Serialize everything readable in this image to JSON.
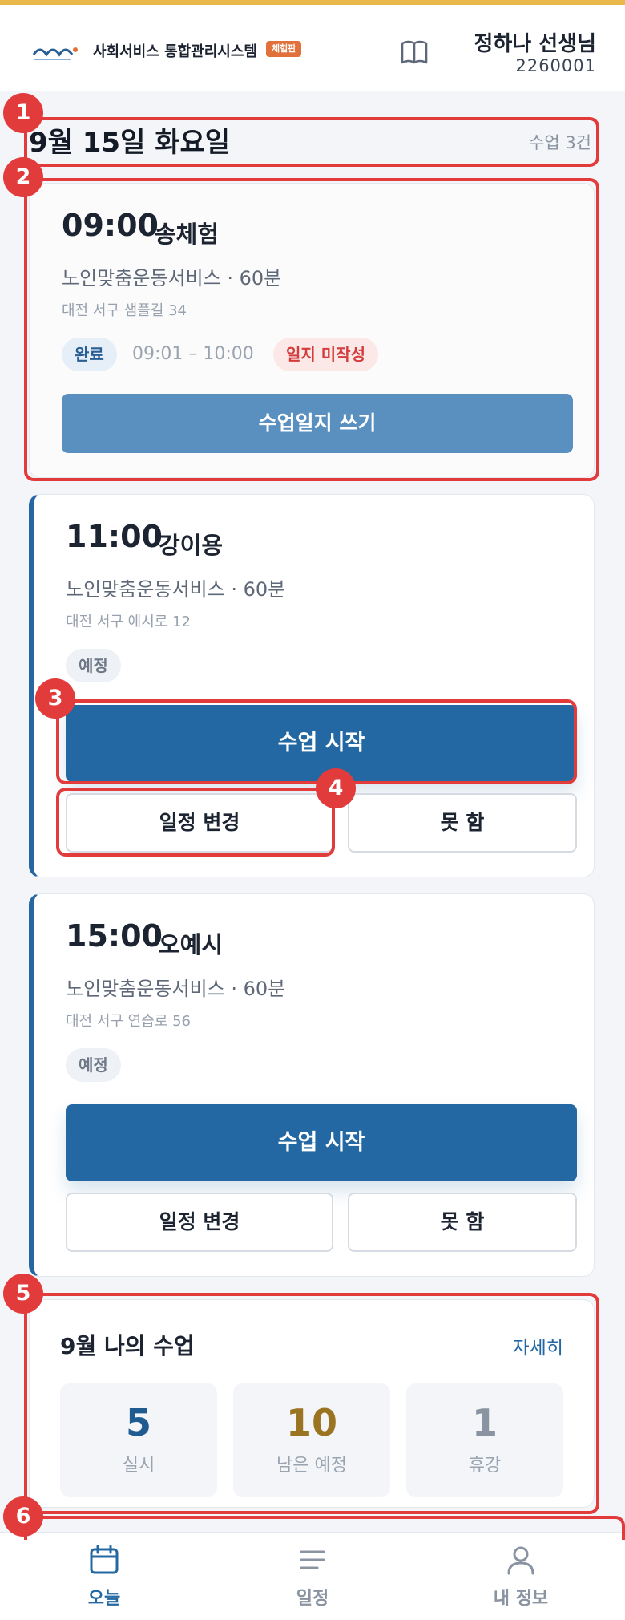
{
  "header": {
    "brand": "사회서비스 통합관리시스템",
    "badge": "체험판",
    "user_name": "정하나 선생님",
    "user_id": "2260001"
  },
  "date_row": {
    "title": "9월 15일 화요일",
    "count": "수업 3건"
  },
  "lessons": [
    {
      "time": "09:00",
      "name": "송체험",
      "service": "노인맞춤운동서비스 · 60분",
      "address": "대전 서구 샘플길 34",
      "status": "완료",
      "done_time": "09:01 – 10:00",
      "warn": "일지 미작성",
      "write_button": "수업일지 쓰기"
    },
    {
      "time": "11:00",
      "name": "강이용",
      "service": "노인맞춤운동서비스 · 60분",
      "address": "대전 서구 예시로 12",
      "status": "예정",
      "start_button": "수업 시작",
      "change_button": "일정 변경",
      "cancel_button": "못 함"
    },
    {
      "time": "15:00",
      "name": "오예시",
      "service": "노인맞춤운동서비스 · 60분",
      "address": "대전 서구 연습로 56",
      "status": "예정",
      "start_button": "수업 시작",
      "change_button": "일정 변경",
      "cancel_button": "못 함"
    }
  ],
  "summary": {
    "title": "9월 나의 수업",
    "more": "자세히",
    "stats": [
      {
        "value": "5",
        "label": "실시",
        "color": "#1f5b91"
      },
      {
        "value": "10",
        "label": "남은 예정",
        "color": "#9a7420"
      },
      {
        "value": "1",
        "label": "휴강",
        "color": "#8a93a1"
      }
    ]
  },
  "nav": [
    {
      "label": "오늘",
      "icon": "calendar-icon",
      "active": true
    },
    {
      "label": "일정",
      "icon": "list-icon",
      "active": false
    },
    {
      "label": "내 정보",
      "icon": "user-icon",
      "active": false
    }
  ],
  "markers": [
    "1",
    "2",
    "3",
    "4",
    "5",
    "6"
  ],
  "colors": {
    "accent": "#2368a3",
    "highlight": "#e23b3b",
    "top_stripe": "#e8b84a"
  }
}
